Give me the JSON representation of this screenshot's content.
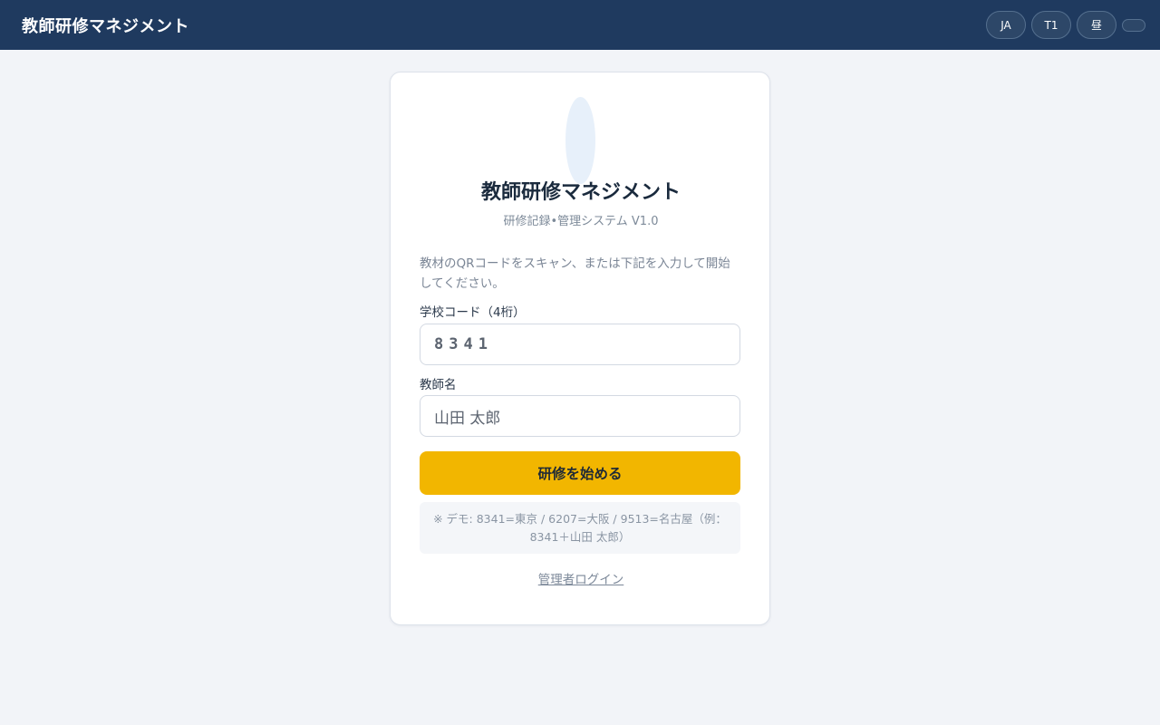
{
  "header": {
    "title": "教師研修マネジメント",
    "lang_label": "JA",
    "t_label": "T1",
    "mode_label": "昼",
    "toggle_label": ""
  },
  "login": {
    "title": "教師研修マネジメント",
    "subtitle": "研修記録•管理システム V1.0",
    "instructions": "教材のQRコードをスキャン、または下記を入力して開始してください。",
    "school_code_label": "学校コード（4桁）",
    "school_code_value": "8341",
    "teacher_name_label": "教師名",
    "teacher_name_value": "山田 太郎",
    "start_button": "研修を始める",
    "demo_note": "※ デモ: 8341=東京 / 6207=大阪 / 9513=名古屋（例：8341＋山田 太郎）",
    "admin_link": "管理者ログイン"
  },
  "colors": {
    "header_bg": "#1f3a5f",
    "accent": "#f2b600",
    "page_bg": "#f2f4f8"
  }
}
